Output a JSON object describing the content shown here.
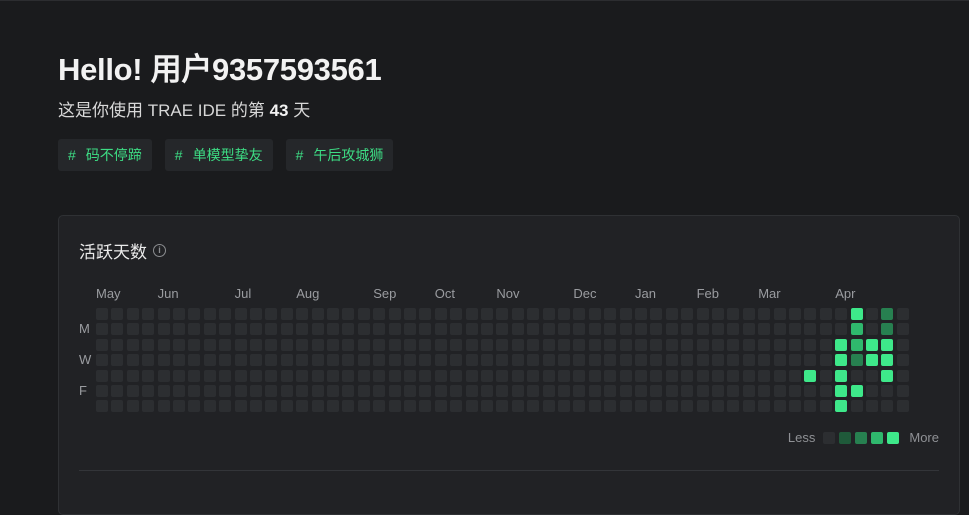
{
  "header": {
    "greeting": "Hello! 用户9357593561",
    "subtitle_prefix": "这是你使用 TRAE IDE 的第",
    "days": "43",
    "subtitle_suffix": "天"
  },
  "tags": [
    {
      "hash": "#",
      "label": "码不停蹄"
    },
    {
      "hash": "#",
      "label": "单模型挚友"
    },
    {
      "hash": "#",
      "label": "午后攻城狮"
    }
  ],
  "activity": {
    "title": "活跃天数",
    "info_icon": "info-icon",
    "months": [
      "May",
      "Jun",
      "Jul",
      "Aug",
      "Sep",
      "Oct",
      "Nov",
      "Dec",
      "Jan",
      "Feb",
      "Mar",
      "Apr"
    ],
    "weekdays": [
      "M",
      "W",
      "F"
    ],
    "legend_less": "Less",
    "legend_more": "More",
    "colors": {
      "empty": "#2c2e31",
      "level1": "#1f5a3a",
      "level2": "#278050",
      "level3": "#2fb86d",
      "level4": "#3ee88a"
    },
    "weeks": 53,
    "days_per_week": 7,
    "active_cells": [
      {
        "week": 46,
        "day": 4,
        "level": 4
      },
      {
        "week": 48,
        "day": 2,
        "level": 4
      },
      {
        "week": 48,
        "day": 3,
        "level": 4
      },
      {
        "week": 48,
        "day": 4,
        "level": 4
      },
      {
        "week": 48,
        "day": 5,
        "level": 4
      },
      {
        "week": 48,
        "day": 6,
        "level": 4
      },
      {
        "week": 49,
        "day": 0,
        "level": 4
      },
      {
        "week": 49,
        "day": 1,
        "level": 3
      },
      {
        "week": 49,
        "day": 2,
        "level": 3
      },
      {
        "week": 49,
        "day": 3,
        "level": 2
      },
      {
        "week": 49,
        "day": 5,
        "level": 4
      },
      {
        "week": 50,
        "day": 2,
        "level": 4
      },
      {
        "week": 50,
        "day": 3,
        "level": 4
      },
      {
        "week": 51,
        "day": 0,
        "level": 2
      },
      {
        "week": 51,
        "day": 1,
        "level": 2
      },
      {
        "week": 51,
        "day": 2,
        "level": 4
      },
      {
        "week": 51,
        "day": 3,
        "level": 4
      },
      {
        "week": 51,
        "day": 4,
        "level": 4
      }
    ]
  }
}
